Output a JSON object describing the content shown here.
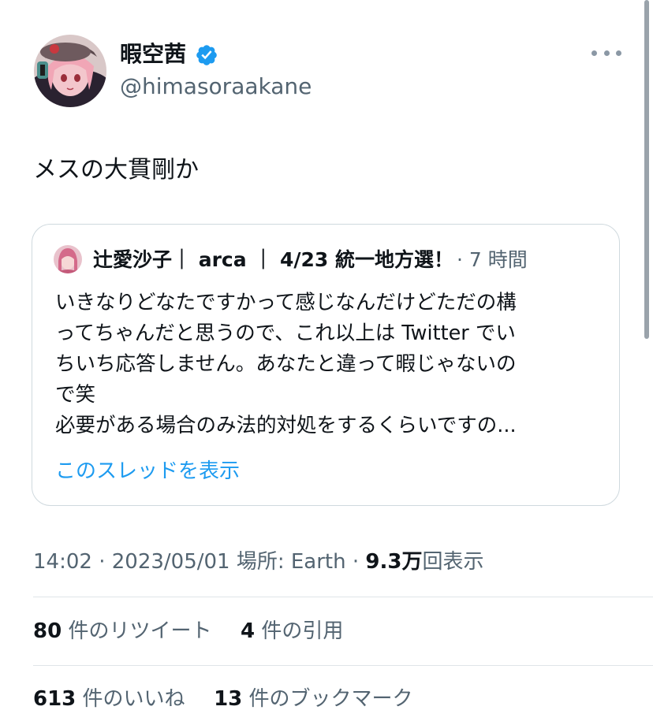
{
  "author": {
    "display_name": "暇空茜",
    "handle": "@himasoraakane",
    "avatar_icon": "anime-girl-avatar",
    "verified_icon": "verified-badge-icon"
  },
  "tweet": {
    "text": "メスの大貫剛か",
    "time": "14:02",
    "date": "2023/05/01",
    "location_label": "場所: Earth",
    "views_count": "9.3万",
    "views_label": "回表示"
  },
  "quote": {
    "author_name": "辻愛沙子｜ arca ｜ 4/23 統一地方選！",
    "time": "· 7 時間",
    "lines": [
      "いきなりどなたですかって感じなんだけどただの構",
      "ってちゃんだと思うので、これ以上は Twitter でい",
      "ちいち応答しません。あなたと違って暇じゃないの",
      "で笑",
      "必要がある場合のみ法的対処をするくらいですの..."
    ],
    "show_thread": "このスレッドを表示"
  },
  "stats": {
    "retweets_count": "80",
    "retweets_label": "件のリツイート",
    "quotes_count": "4",
    "quotes_label": "件の引用",
    "likes_count": "613",
    "likes_label": "件のいいね",
    "bookmarks_count": "13",
    "bookmarks_label": "件のブックマーク"
  },
  "colors": {
    "accent": "#1d9bf0",
    "secondary_text": "#536471",
    "border": "#cfd9de"
  }
}
